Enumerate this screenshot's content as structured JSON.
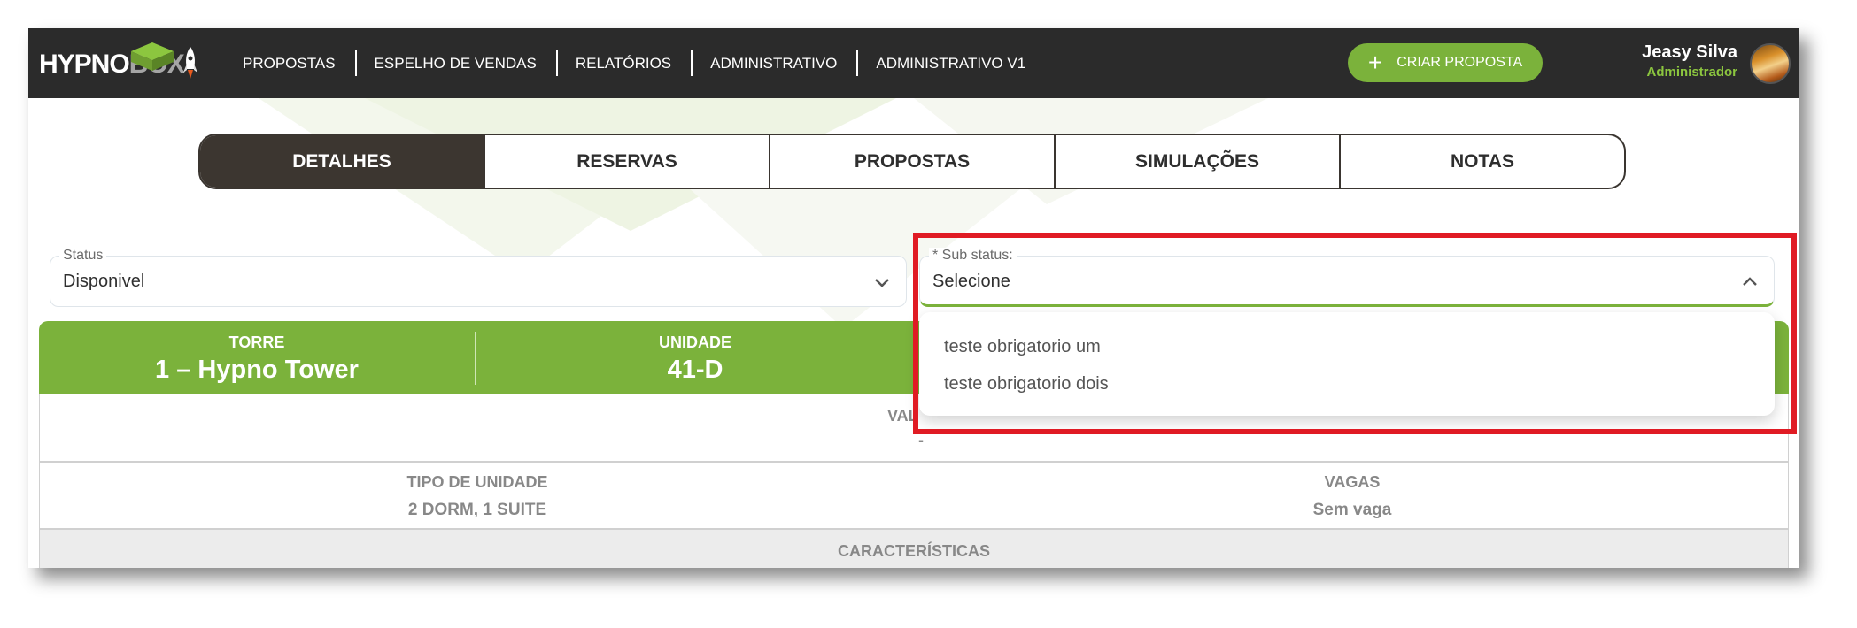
{
  "brand": {
    "logo_part1": "HYPNO",
    "logo_part2": "BOX"
  },
  "nav": {
    "items": [
      "PROPOSTAS",
      "ESPELHO DE VENDAS",
      "RELATÓRIOS",
      "ADMINISTRATIVO",
      "ADMINISTRATIVO V1"
    ]
  },
  "cta": {
    "label": "CRIAR PROPOSTA",
    "plus": "+"
  },
  "user": {
    "name": "Jeasy Silva",
    "role": "Administrador"
  },
  "tabs": [
    {
      "label": "DETALHES",
      "active": true
    },
    {
      "label": "RESERVAS",
      "active": false
    },
    {
      "label": "PROPOSTAS",
      "active": false
    },
    {
      "label": "SIMULAÇÕES",
      "active": false
    },
    {
      "label": "NOTAS",
      "active": false
    }
  ],
  "status_field": {
    "label": "Status",
    "value": "Disponivel"
  },
  "sub_status_field": {
    "label": "* Sub status:",
    "value": "Selecione",
    "expanded": true
  },
  "dropdown_options": [
    "teste obrigatorio um",
    "teste obrigatorio dois"
  ],
  "unit_header": {
    "torre_label": "TORRE",
    "torre_value": "1 – Hypno Tower",
    "unidade_label": "UNIDADE",
    "unidade_value": "41-D"
  },
  "valor": {
    "label": "VAL",
    "value": "-"
  },
  "details": {
    "tipo_label": "TIPO DE UNIDADE",
    "tipo_value": "2 DORM, 1 SUITE",
    "vagas_label": "VAGAS",
    "vagas_value": "Sem vaga"
  },
  "caracteristicas": {
    "label": "CARACTERÍSTICAS"
  },
  "colors": {
    "accent": "#7bb23b",
    "dark": "#2b2b2b",
    "tab_active": "#3c3630",
    "highlight": "#e01b24"
  }
}
